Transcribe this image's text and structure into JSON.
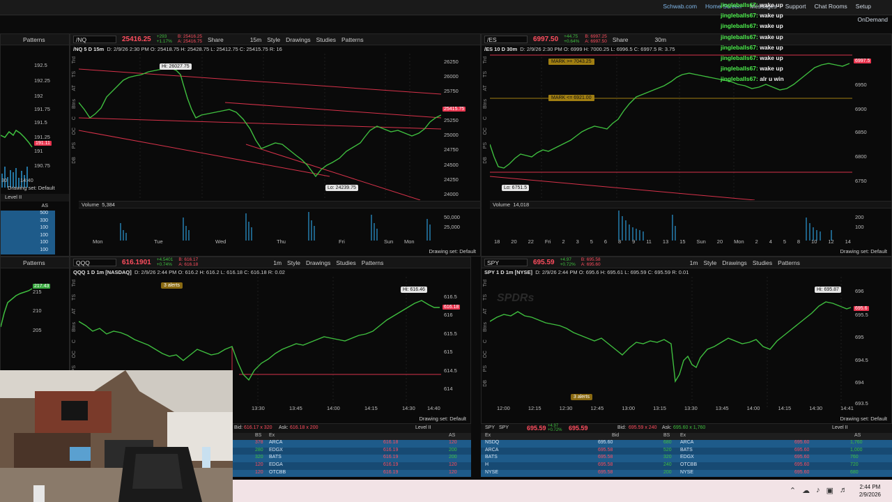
{
  "topbar": {
    "links": [
      "Schwab.com",
      "Home Screen",
      "Messages",
      "Support",
      "Chat Rooms",
      "Setup"
    ],
    "ondemand": "OnDemand"
  },
  "chat": [
    {
      "user": "jingleballs67:",
      "msg": "wake up"
    },
    {
      "user": "jingleballs67:",
      "msg": "wake up"
    },
    {
      "user": "jingleballs67:",
      "msg": "wake up"
    },
    {
      "user": "jingleballs67:",
      "msg": "wake up"
    },
    {
      "user": "jingleballs67:",
      "msg": "wake up"
    },
    {
      "user": "jingleballs67:",
      "msg": "wake up"
    },
    {
      "user": "jingleballs67:",
      "msg": "wake up"
    },
    {
      "user": "jingleballs67:",
      "msg": "alr u win"
    }
  ],
  "toolbar": {
    "share": "Share",
    "style": "Style",
    "drawings": "Drawings",
    "studies": "Studies",
    "patterns": "Patterns",
    "drawing_set": "Drawing set: Default",
    "level2": "Level II",
    "volume": "Volume"
  },
  "sidebar_labels": [
    "Trd",
    "TS",
    "AT",
    "Btns",
    "C",
    "OC",
    "PS",
    "DB",
    "L2"
  ],
  "left_panel": {
    "patterns": "Patterns",
    "yticks": [
      "192.5",
      "192.25",
      "192",
      "191.75",
      "191.5",
      "191.25",
      "191",
      "190.75",
      "190.5"
    ],
    "price_tag": "191.11",
    "xticks": [
      "30",
      "14:40"
    ],
    "drawing_set": "Drawing set: Default",
    "level2": "Level II",
    "as_head": "AS",
    "as_values": [
      "500",
      "330",
      "100",
      "100",
      "100",
      "100"
    ],
    "yticks2": [
      "215",
      "210",
      "205"
    ],
    "price_tag2": "217.43"
  },
  "nq": {
    "symbol": "/NQ",
    "price": "25416.25",
    "chg1": "+293",
    "chg2": "+1.17%",
    "bid": "B: 25416.25",
    "ask": "A: 25416.75",
    "interval": "15m",
    "header": "/NQ 5 D 15m",
    "ohlc": "D: 2/9/26 2:30 PM  O: 25418.75  H: 25428.75  L: 25412.75  C: 25415.75  R: 16",
    "hi": "Hi: 26027.75",
    "lo": "Lo: 24239.75",
    "last_tag": "25415.75",
    "yticks": [
      "26250",
      "26000",
      "25750",
      "25500",
      "25250",
      "25000",
      "24750",
      "24500",
      "24250",
      "24000"
    ],
    "volume_val": "5,384",
    "vticks": [
      "50,000",
      "25,000"
    ],
    "xticks": [
      "Mon",
      "Tue",
      "Wed",
      "Thu",
      "Fri",
      "Sun",
      "Mon"
    ]
  },
  "es": {
    "symbol": "/ES",
    "price": "6997.50",
    "chg1": "+44.75",
    "chg2": "+0.64%",
    "bid": "B: 6997.25",
    "ask": "A: 6997.50",
    "interval": "30m",
    "header": "/ES 10 D 30m",
    "ohlc": "D: 2/9/26 2:30 PM  O: 6999  H: 7000.25  L: 6996.5  C: 6997.5  R: 3.75",
    "mark_hi": "MARK >= 7043.25",
    "mark_lo": "MARK <= 6921.00",
    "lo": "Lo: 6751.5",
    "last_tag": "6997.5",
    "yticks": [
      "6950",
      "6900",
      "6850",
      "6800",
      "6750"
    ],
    "volume_val": "14,018",
    "vticks": [
      "200",
      "100"
    ],
    "vunit": "thousan",
    "xticks": [
      "18",
      "20",
      "22",
      "Fri",
      "2",
      "3",
      "5",
      "6",
      "8",
      "9",
      "11",
      "13",
      "15",
      "Sun",
      "20",
      "Mon",
      "2",
      "4",
      "5",
      "8",
      "10",
      "12",
      "14"
    ]
  },
  "qqq": {
    "symbol": "QQQ",
    "price": "616.1901",
    "chg1": "+4.5401",
    "chg2": "+0.74%",
    "bid": "B: 616.17",
    "ask": "A: 616.18",
    "interval": "1m",
    "header": "QQQ 1 D 1m [NASDAQ]",
    "ohlc": "D: 2/9/26 2:44 PM  O: 616.2  H: 616.2  L: 616.18  C: 616.18  R: 0.02",
    "alerts": "3 alerts",
    "hi": "Hi: 616.46",
    "last_tag": "616.18",
    "yticks": [
      "616.5",
      "616",
      "615.5",
      "615",
      "614.5",
      "614"
    ],
    "xticks": [
      "13:30",
      "13:45",
      "14:00",
      "14:15",
      "14:30",
      "14:40"
    ]
  },
  "spy": {
    "symbol": "SPY",
    "price": "695.59",
    "chg1": "+4.97",
    "chg2": "+0.72%",
    "bid": "B: 695.58",
    "ask": "A: 695.60",
    "interval": "1m",
    "header": "SPY 1 D 1m [NYSE]",
    "ohlc": "D: 2/9/26 2:44 PM  O: 695.6  H: 695.61  L: 695.59  C: 695.59  R: 0.01",
    "watermark": "SPDRs",
    "alerts": "3 alerts",
    "hi": "Hi: 695.87",
    "last_tag": "695.6",
    "yticks": [
      "696",
      "695.5",
      "695",
      "694.5",
      "694",
      "693.5"
    ],
    "xticks": [
      "12:00",
      "12:15",
      "12:30",
      "12:45",
      "13:00",
      "13:15",
      "13:30",
      "13:45",
      "14:00",
      "14:15",
      "14:30",
      "14:41"
    ]
  },
  "qqq_l2": {
    "bid_label": "Bid:",
    "bid": "616.17 x 320",
    "ask_label": "Ask:",
    "ask": "616.18 x 200",
    "level": "Level II",
    "head": {
      "bs": "BS",
      "ex": "Ex",
      "as": "AS"
    },
    "rows": [
      {
        "bs": "378",
        "ex": "ARCA",
        "px": "616.18",
        "as": "120"
      },
      {
        "bs": "280",
        "ex": "EDGX",
        "px": "616.19",
        "as": "200"
      },
      {
        "bs": "320",
        "ex": "BATS",
        "px": "616.19",
        "as": "200"
      },
      {
        "bs": "120",
        "ex": "EDGA",
        "px": "616.19",
        "as": "120"
      },
      {
        "bs": "120",
        "ex": "OTCBB",
        "px": "616.19",
        "as": "120"
      }
    ]
  },
  "spy_l2": {
    "sym1": "SPY",
    "sym2": "SPY",
    "price": "695.59",
    "chg1": "+4.97",
    "chg2": "+0.72%",
    "price2": "695.59",
    "bid_label": "Bid:",
    "bid": "695.59 x 240",
    "ask_label": "Ask:",
    "ask": "695.60 x 1,760",
    "level": "Level II",
    "head": {
      "ex": "Ex",
      "bid": "Bid",
      "bs": "BS",
      "ex2": "Ex",
      "as": "AS"
    },
    "rows": [
      {
        "ex": "NSDQ",
        "bid": "695.60",
        "bs": "680",
        "ex2": "ARCA",
        "ask": "695.60",
        "as": "1,760"
      },
      {
        "ex": "ARCA",
        "bid": "695.58",
        "bs": "520",
        "ex2": "BATS",
        "ask": "695.60",
        "as": "1,000"
      },
      {
        "ex": "BATS",
        "bid": "695.58",
        "bs": "320",
        "ex2": "EDGX",
        "ask": "695.60",
        "as": "760"
      },
      {
        "ex": "H",
        "bid": "695.58",
        "bs": "240",
        "ex2": "OTCBB",
        "ask": "695.60",
        "as": "720"
      },
      {
        "ex": "NYSE",
        "bid": "695.58",
        "bs": "200",
        "ex2": "NYSE",
        "ask": "695.60",
        "as": "680"
      }
    ]
  },
  "taskbar": {
    "time": "2:44 PM",
    "date": "2/9/2026"
  },
  "colors": {
    "up": "#3fbf3f",
    "down": "#ff4d5e",
    "trend": "#e8344e",
    "mark": "#a17f12",
    "vol": "#2a90c8",
    "chat_user": "#4ef04e"
  }
}
